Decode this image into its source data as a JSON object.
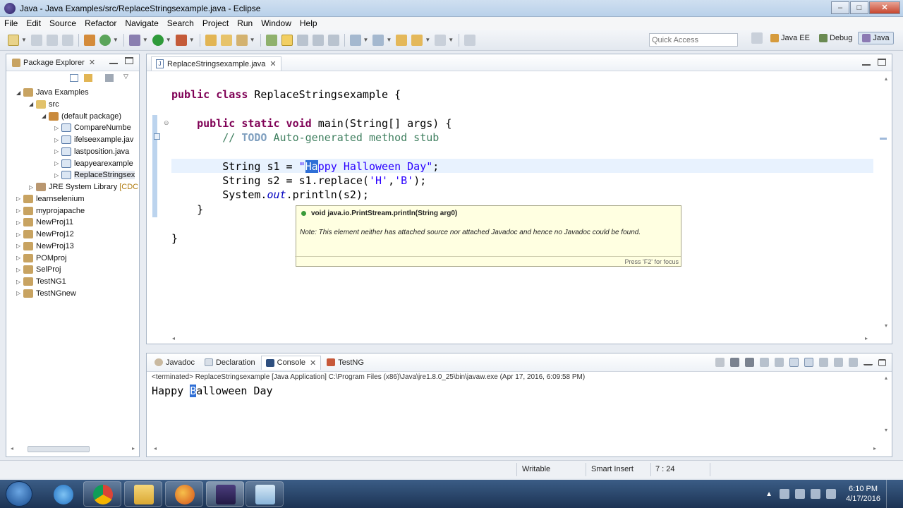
{
  "window": {
    "title": "Java - Java Examples/src/ReplaceStringsexample.java - Eclipse",
    "min": "–",
    "max": "□",
    "close": "✕"
  },
  "menu": [
    "File",
    "Edit",
    "Source",
    "Refactor",
    "Navigate",
    "Search",
    "Project",
    "Run",
    "Window",
    "Help"
  ],
  "toolbar": {
    "quick_access_placeholder": "Quick Access"
  },
  "perspectives": [
    {
      "label": "Java EE",
      "active": false
    },
    {
      "label": "Debug",
      "active": false
    },
    {
      "label": "Java",
      "active": true
    }
  ],
  "package_explorer": {
    "title": "Package Explorer",
    "items": [
      {
        "label": "Java Examples",
        "type": "project",
        "expanded": true
      },
      {
        "label": "src",
        "type": "folder",
        "expanded": true
      },
      {
        "label": "(default package)",
        "type": "package",
        "expanded": true
      },
      {
        "label": "CompareNumbe",
        "type": "java"
      },
      {
        "label": "ifelseexample.jav",
        "type": "java"
      },
      {
        "label": "lastposition.java",
        "type": "java"
      },
      {
        "label": "leapyearexample",
        "type": "java"
      },
      {
        "label": "ReplaceStringsex",
        "type": "java",
        "selected": true
      },
      {
        "label": "JRE System Library",
        "suffix": "[CDC",
        "type": "library"
      },
      {
        "label": "learnselenium",
        "type": "project"
      },
      {
        "label": "myprojapache",
        "type": "project"
      },
      {
        "label": "NewProj11",
        "type": "project"
      },
      {
        "label": "NewProj12",
        "type": "project"
      },
      {
        "label": "NewProj13",
        "type": "project"
      },
      {
        "label": "POMproj",
        "type": "project"
      },
      {
        "label": "SelProj",
        "type": "project"
      },
      {
        "label": "TestNG1",
        "type": "project"
      },
      {
        "label": "TestNGnew",
        "type": "project"
      }
    ]
  },
  "editor": {
    "tab_label": "ReplaceStringsexample.java",
    "code": {
      "l1_kw": "public class",
      "l1_rest": " ReplaceStringsexample {",
      "l2_kw": "public static void",
      "l2_rest": " main(String[] args) {",
      "l3_cm1": "// ",
      "l3_todo": "TODO",
      "l3_cm2": " Auto-generated method stub",
      "l4_a": "String s1 = ",
      "l4_q": "\"",
      "l4_hl": "Ha",
      "l4_str": "ppy Halloween Day\"",
      "l4_end": ";",
      "l5_a": "String s2 = s1.replace(",
      "l5_s1": "'H'",
      "l5_comma": ",",
      "l5_s2": "'B'",
      "l5_end": ");",
      "l6_a": "System.",
      "l6_it": "out",
      "l6_b": ".println(s2);",
      "l7": "}",
      "l8": "}"
    }
  },
  "hover": {
    "signature": "void java.io.PrintStream.println(String arg0)",
    "note": "Note: This element neither has attached source nor attached Javadoc and hence no Javadoc could be found.",
    "footer": "Press 'F2' for focus"
  },
  "console": {
    "tabs": [
      {
        "label": "Javadoc",
        "active": false
      },
      {
        "label": "Declaration",
        "active": false
      },
      {
        "label": "Console",
        "active": true
      },
      {
        "label": "TestNG",
        "active": false
      }
    ],
    "terminated": "<terminated> ReplaceStringsexample [Java Application] C:\\Program Files (x86)\\Java\\jre1.8.0_25\\bin\\javaw.exe (Apr 17, 2016, 6:09:58 PM)",
    "output_a": "Happy ",
    "output_hl": "B",
    "output_b": "alloween Day"
  },
  "status": {
    "mode": "Writable",
    "insert": "Smart Insert",
    "position": "7 : 24"
  },
  "taskbar": {
    "time": "6:10 PM",
    "date": "4/17/2016"
  },
  "colors": {
    "accent": "#2f6fd6",
    "keyword": "#7f0055",
    "comment": "#3f7f5f",
    "string": "#2a00ff"
  }
}
